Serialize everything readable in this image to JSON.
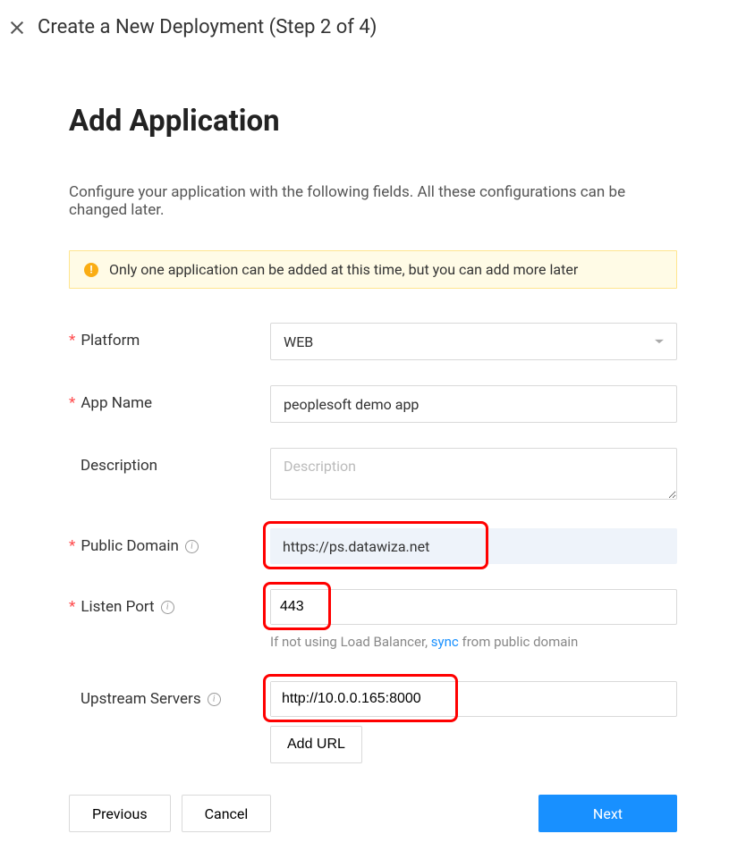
{
  "header": {
    "title": "Create a New Deployment (Step 2 of 4)"
  },
  "page": {
    "title": "Add Application",
    "subtitle": "Configure your application with the following fields. All these configurations can be changed later."
  },
  "alert": {
    "text": "Only one application can be added at this time, but you can add more later"
  },
  "form": {
    "platform": {
      "label": "Platform",
      "value": "WEB"
    },
    "appName": {
      "label": "App Name",
      "value": "peoplesoft demo app"
    },
    "description": {
      "label": "Description",
      "placeholder": "Description",
      "value": ""
    },
    "publicDomain": {
      "label": "Public Domain",
      "value": "https://ps.datawiza.net"
    },
    "listenPort": {
      "label": "Listen Port",
      "value": "443",
      "hint_prefix": "If not using Load Balancer, ",
      "hint_link": "sync",
      "hint_suffix": " from public domain"
    },
    "upstreamServers": {
      "label": "Upstream Servers",
      "value": "http://10.0.0.165:8000",
      "addUrl": "Add URL"
    }
  },
  "footer": {
    "previous": "Previous",
    "cancel": "Cancel",
    "next": "Next"
  }
}
